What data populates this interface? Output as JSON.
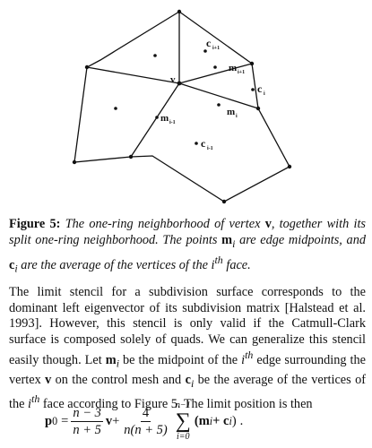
{
  "figure": {
    "labels": {
      "c_next": "c",
      "c_next_sub": "i+1",
      "m_next": "m",
      "m_next_sub": "i+1",
      "c_i": "c",
      "c_i_sub": "i",
      "m_i": "m",
      "m_i_sub": "i",
      "m_prev": "m",
      "m_prev_sub": "i-1",
      "c_prev": "c",
      "c_prev_sub": "i-1",
      "v": "v"
    }
  },
  "caption": {
    "label": "Figure 5:",
    "t1": "The one-ring neighborhood of vertex",
    "v": "v",
    "t2": ", together with its split one-ring neighborhood. The points",
    "m": "m",
    "i1": "i",
    "t3": "are edge midpoints, and",
    "c": "c",
    "i2": "i",
    "t4": "are the average of the vertices of the",
    "i3": "i",
    "th": "th",
    "t5": "face."
  },
  "body": {
    "p1": "The limit stencil for a subdivision surface corresponds to the dominant left eigenvector of its subdivision matrix [Halstead et al. 1993]. However, this stencil is only valid if the Catmull-Clark surface is composed solely of quads. We can generalize this stencil easily though. Let",
    "m": "m",
    "i1": "i",
    "p2": "be the midpoint of the",
    "i2": "i",
    "th1": "th",
    "p3": "edge surrounding the vertex",
    "v": "v",
    "p4": "on the control mesh and",
    "c": "c",
    "i3": "i",
    "p5": "be the average of the vertices of the",
    "i4": "i",
    "th2": "th",
    "p6": "face according to Figure 5. The limit position is then"
  },
  "equation": {
    "lhs": "p",
    "lhs_sub": "0",
    "eq": "=",
    "frac1_num": "n − 3",
    "frac1_den": "n + 5",
    "v": "v",
    "plus": "+",
    "frac2_num": "4",
    "frac2_den": "n(n + 5)",
    "sum_top": "n−1",
    "sum_sym": "∑",
    "sum_bot": "i=0",
    "term": "(m",
    "term_i": "i",
    "term_plus": " + c",
    "term_i2": "i",
    "term_close": ")",
    "period": "."
  }
}
